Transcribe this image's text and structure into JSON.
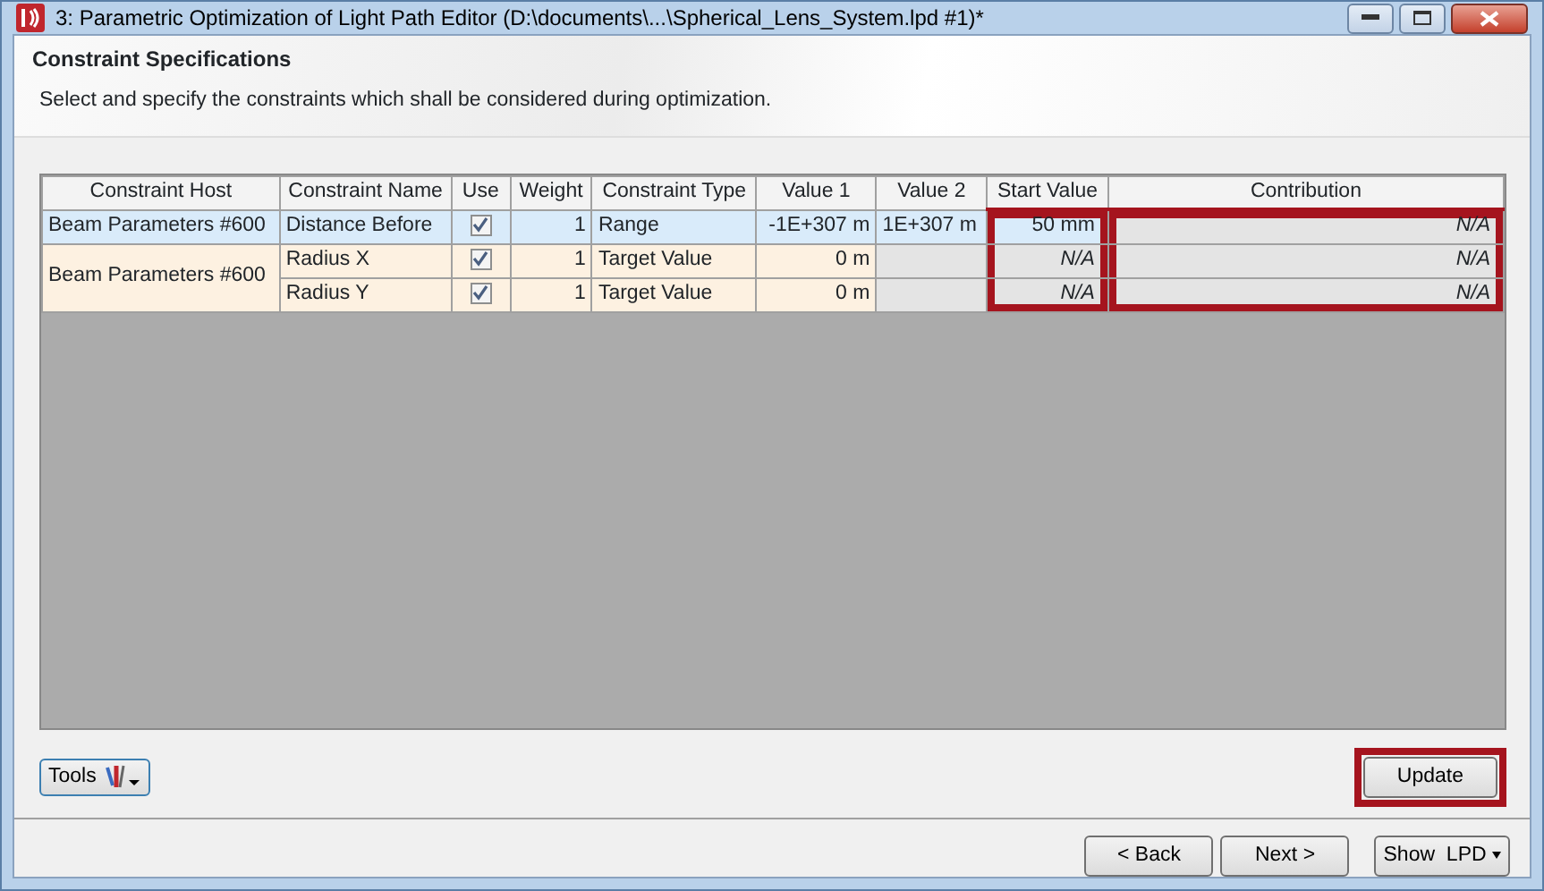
{
  "window": {
    "title": "3: Parametric Optimization of Light Path Editor (D:\\documents\\...\\Spherical_Lens_System.lpd #1)*"
  },
  "header": {
    "title": "Constraint Specifications",
    "description": "Select and specify the constraints which shall be considered during optimization."
  },
  "table": {
    "columns": [
      {
        "label": "Constraint Host",
        "highlighted": false
      },
      {
        "label": "Constraint Name",
        "highlighted": false
      },
      {
        "label": "Use",
        "highlighted": false
      },
      {
        "label": "Weight",
        "highlighted": false
      },
      {
        "label": "Constraint Type",
        "highlighted": false
      },
      {
        "label": "Value 1",
        "highlighted": false
      },
      {
        "label": "Value 2",
        "highlighted": false
      },
      {
        "label": "Start Value",
        "highlighted": true
      },
      {
        "label": "Contribution",
        "highlighted": true
      }
    ],
    "groups": [
      {
        "host": "Beam Parameters #600",
        "selected": true,
        "rows": [
          {
            "name": "Distance Before",
            "use": true,
            "weight": "1",
            "type": "Range",
            "value_1": "-1E+307 m",
            "value_2": "1E+307 m",
            "start_value": "50 mm",
            "start_value_editable": true,
            "contribution": "N/A"
          }
        ]
      },
      {
        "host": "Beam Parameters #600",
        "selected": false,
        "rows": [
          {
            "name": "Radius X",
            "use": true,
            "weight": "1",
            "type": "Target Value",
            "value_1": "0 m",
            "start_value": "N/A",
            "start_value_editable": false,
            "contribution": "N/A"
          },
          {
            "name": "Radius Y",
            "use": true,
            "weight": "1",
            "type": "Target Value",
            "value_1": "0 m",
            "start_value": "N/A",
            "start_value_editable": false,
            "contribution": "N/A"
          }
        ]
      }
    ]
  },
  "tools_button": {
    "label": "Tools"
  },
  "update_button": {
    "label": "Update",
    "highlighted": true
  },
  "nav_buttons": [
    {
      "label": "< Back",
      "kind": "plain"
    },
    {
      "label": "Next >",
      "kind": "plain"
    },
    {
      "label": "Show  LPD",
      "kind": "dropdown"
    }
  ]
}
